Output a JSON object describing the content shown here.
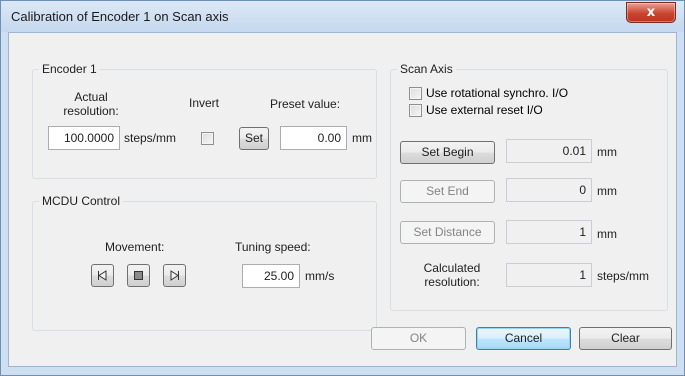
{
  "window": {
    "title": "Calibration of Encoder 1 on Scan axis",
    "close_glyph": "x"
  },
  "encoder": {
    "legend": "Encoder 1",
    "actual_resolution_label": "Actual resolution:",
    "actual_resolution_value": "100.0000",
    "resolution_unit": "steps/mm",
    "invert_label": "Invert",
    "invert_checked": false,
    "preset_label": "Preset value:",
    "set_button": "Set",
    "preset_value": "0.00",
    "preset_unit": "mm"
  },
  "mcdu": {
    "legend": "MCDU Control",
    "movement_label": "Movement:",
    "movement_icons": [
      "step-left-icon",
      "stop-icon",
      "step-right-icon"
    ],
    "tuning_label": "Tuning speed:",
    "tuning_value": "25.00",
    "tuning_unit": "mm/s"
  },
  "scan": {
    "legend": "Scan Axis",
    "use_rotational_label": "Use rotational synchro. I/O",
    "use_rotational_checked": false,
    "use_external_label": "Use external reset I/O",
    "use_external_checked": false,
    "set_begin_button": "Set Begin",
    "begin_value": "0.01",
    "begin_unit": "mm",
    "set_end_button": "Set End",
    "end_value": "0",
    "end_unit": "mm",
    "set_distance_button": "Set Distance",
    "distance_value": "1",
    "distance_unit": "mm",
    "calculated_label": "Calculated resolution:",
    "calculated_value": "1",
    "calculated_unit": "steps/mm"
  },
  "footer": {
    "ok_button": "OK",
    "cancel_button": "Cancel",
    "clear_button": "Clear"
  },
  "colors": {
    "frame": "#cfdff2",
    "client": "#f0f0f0",
    "close_button": "#c9452f",
    "default_button_border": "#3c7fb1"
  }
}
